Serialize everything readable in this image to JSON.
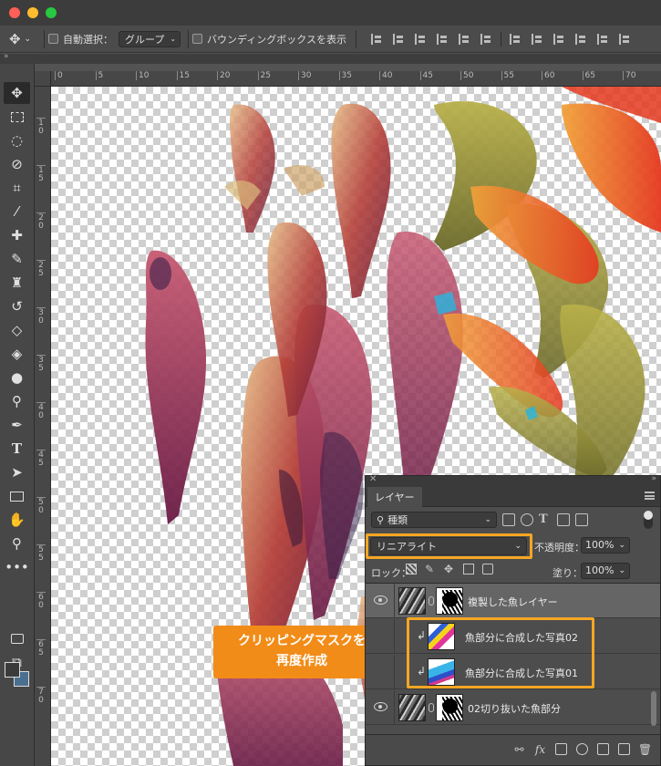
{
  "options_bar": {
    "auto_select_label": "自動選択：",
    "auto_select_value": "グループ",
    "bounding_box_label": "バウンディングボックスを表示"
  },
  "ruler_top_ticks": [
    "0",
    "5",
    "10",
    "15",
    "20",
    "25",
    "30",
    "35",
    "40",
    "45",
    "50",
    "55",
    "60",
    "65",
    "70"
  ],
  "ruler_left_ticks": [
    "10",
    "15",
    "20",
    "25",
    "30",
    "35",
    "40",
    "45",
    "50",
    "55",
    "60",
    "65",
    "70"
  ],
  "layers_panel": {
    "tab_label": "レイヤー",
    "filter_label": "種類",
    "blend_mode": "リニアライト",
    "opacity_label": "不透明度：",
    "opacity_value": "100%",
    "lock_label": "ロック：",
    "fill_label": "塗り：",
    "fill_value": "100%",
    "layers": [
      {
        "name": "複製した魚レイヤー",
        "selected": true
      },
      {
        "name": "魚部分に合成した写真02",
        "clipped": true
      },
      {
        "name": "魚部分に合成した写真01",
        "clipped": true
      },
      {
        "name": "02切り抜いた魚部分"
      }
    ]
  },
  "callout": {
    "line1": "クリッピングマスクを",
    "line2": "再度作成"
  },
  "colors": {
    "highlight": "#f5a623",
    "callout_bg": "#f28c18",
    "background_swatch": "#4b6f8f"
  }
}
